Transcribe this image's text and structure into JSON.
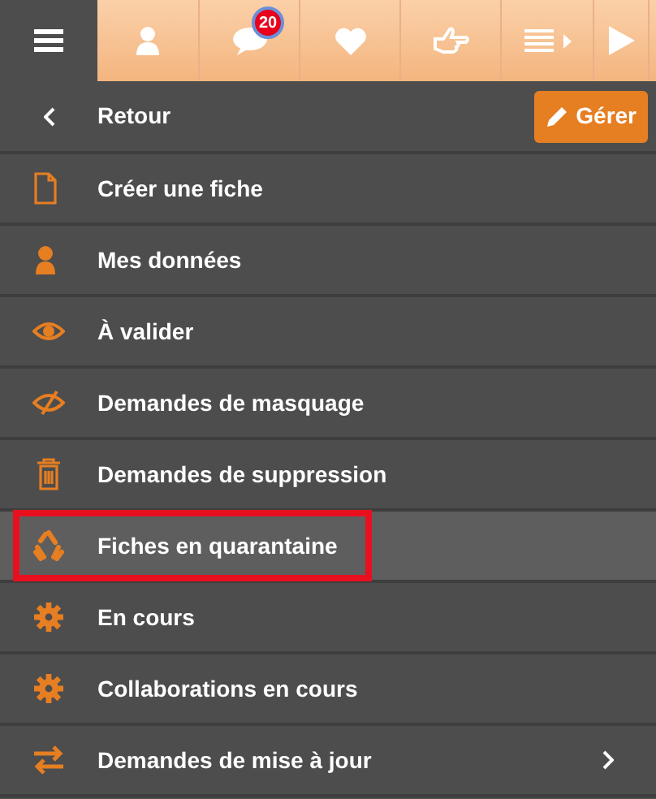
{
  "toolbar": {
    "badge": "20"
  },
  "header": {
    "back": "Retour",
    "manage_button": "Gérer"
  },
  "menu": [
    {
      "label": "Créer une fiche",
      "selected": false,
      "has_submenu": false
    },
    {
      "label": "Mes données",
      "selected": false,
      "has_submenu": false
    },
    {
      "label": "À valider",
      "selected": false,
      "has_submenu": false
    },
    {
      "label": "Demandes de masquage",
      "selected": false,
      "has_submenu": false
    },
    {
      "label": "Demandes de suppression",
      "selected": false,
      "has_submenu": false
    },
    {
      "label": "Fiches en quarantaine",
      "selected": true,
      "has_submenu": false
    },
    {
      "label": "En cours",
      "selected": false,
      "has_submenu": false
    },
    {
      "label": "Collaborations en cours",
      "selected": false,
      "has_submenu": false
    },
    {
      "label": "Demandes de mise à jour",
      "selected": false,
      "has_submenu": true
    }
  ]
}
